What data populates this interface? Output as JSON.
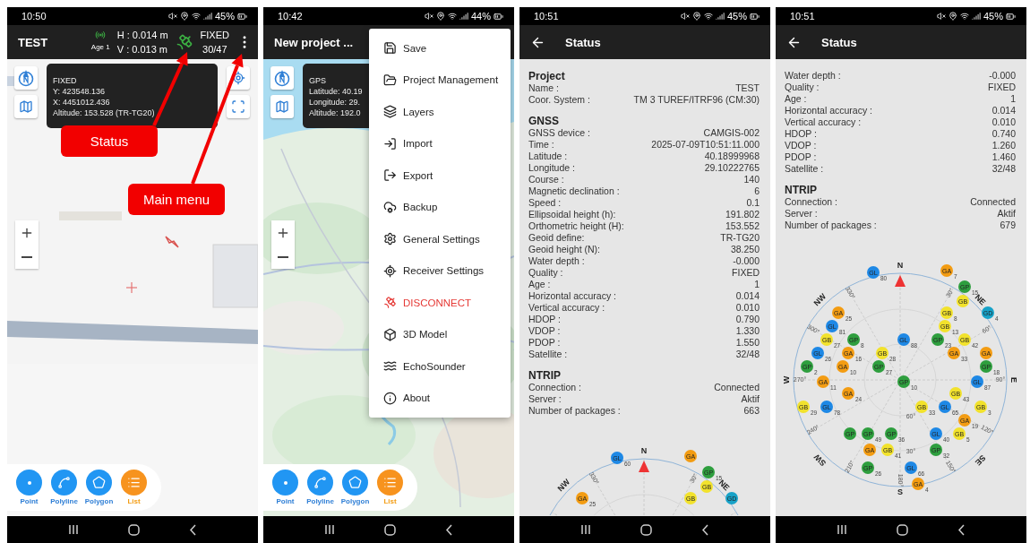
{
  "screens": [
    {
      "kind": "map",
      "status_bar": {
        "time": "10:50",
        "battery": "45%"
      },
      "app_bar": {
        "title": "TEST",
        "gnss": {
          "age": "Age 1",
          "h": "H : 0.014 m",
          "v": "V : 0.013 m",
          "fix": "FIXED",
          "satellites": "30/47"
        }
      },
      "info_card": [
        "FIXED",
        "Y: 423548.136",
        "X: 4451012.436",
        "Altitude: 153.528 (TR-TG20)"
      ],
      "annotations": [
        "Status",
        "Main menu"
      ],
      "toolbar": [
        {
          "label": "Point",
          "kind": "point",
          "selected": false
        },
        {
          "label": "Polyline",
          "kind": "polyline",
          "selected": false
        },
        {
          "label": "Polygon",
          "kind": "polygon",
          "selected": false
        },
        {
          "label": "List",
          "kind": "list",
          "selected": true
        }
      ]
    },
    {
      "kind": "map",
      "status_bar": {
        "time": "10:42",
        "battery": "44%"
      },
      "app_bar": {
        "title": "New project ..."
      },
      "info_card": [
        "GPS",
        "Latitude: 40.19",
        "Longitude: 29.",
        "Altitude: 192.0"
      ],
      "menu": [
        {
          "label": "Save",
          "kind": "normal"
        },
        {
          "label": "Project Management",
          "kind": "normal"
        },
        {
          "label": "Layers",
          "kind": "normal"
        },
        {
          "label": "Import",
          "kind": "normal"
        },
        {
          "label": "Export",
          "kind": "normal"
        },
        {
          "label": "Backup",
          "kind": "normal"
        },
        {
          "label": "General Settings",
          "kind": "normal"
        },
        {
          "label": "Receiver Settings",
          "kind": "normal"
        },
        {
          "label": "DISCONNECT",
          "kind": "danger"
        },
        {
          "label": "3D Model",
          "kind": "normal"
        },
        {
          "label": "EchoSounder",
          "kind": "normal"
        },
        {
          "label": "About",
          "kind": "normal"
        }
      ],
      "toolbar": [
        {
          "label": "Point",
          "kind": "point",
          "selected": false
        },
        {
          "label": "Polyline",
          "kind": "polyline",
          "selected": false
        },
        {
          "label": "Polygon",
          "kind": "polygon",
          "selected": false
        },
        {
          "label": "List",
          "kind": "list",
          "selected": true
        }
      ]
    },
    {
      "kind": "status",
      "status_bar": {
        "time": "10:51",
        "battery": "45%"
      },
      "app_bar": {
        "title": "Status"
      },
      "sections": [
        {
          "title": "Project",
          "rows": [
            {
              "label": "Name :",
              "value": "TEST"
            },
            {
              "label": "Coor. System :",
              "value": "TM 3 TUREF/ITRF96 (CM:30)"
            }
          ]
        },
        {
          "title": "GNSS",
          "rows": [
            {
              "label": "GNSS device :",
              "value": "CAMGIS-002"
            },
            {
              "label": "Time :",
              "value": "2025-07-09T10:51:11.000"
            },
            {
              "label": "Latitude :",
              "value": "40.18999968"
            },
            {
              "label": "Longitude :",
              "value": "29.10222765"
            },
            {
              "label": "Course :",
              "value": "140"
            },
            {
              "label": "Magnetic declination :",
              "value": "6"
            },
            {
              "label": "Speed :",
              "value": "0.1"
            },
            {
              "label": "Ellipsoidal height (h):",
              "value": "191.802"
            },
            {
              "label": "Orthometric height (H):",
              "value": "153.552"
            },
            {
              "label": "Geoid define:",
              "value": "TR-TG20"
            },
            {
              "label": "Geoid height (N):",
              "value": "38.250"
            },
            {
              "label": "Water depth :",
              "value": "-0.000"
            },
            {
              "label": "Quality :",
              "value": "FIXED"
            },
            {
              "label": "Age :",
              "value": "1"
            },
            {
              "label": "Horizontal accuracy :",
              "value": "0.014"
            },
            {
              "label": "Vertical accuracy :",
              "value": "0.010"
            },
            {
              "label": "HDOP :",
              "value": "0.790"
            },
            {
              "label": "VDOP :",
              "value": "1.330"
            },
            {
              "label": "PDOP :",
              "value": "1.550"
            },
            {
              "label": "Satellite :",
              "value": "32/48"
            }
          ]
        },
        {
          "title": "NTRIP",
          "rows": [
            {
              "label": "Connection :",
              "value": "Connected"
            },
            {
              "label": "Server :",
              "value": "Aktif"
            },
            {
              "label": "Number of packages :",
              "value": "663"
            }
          ]
        }
      ],
      "skyplot": {
        "directions": [
          "N",
          "NE",
          "NW"
        ],
        "azimuth_labels": [
          "330°",
          "30°"
        ],
        "satellites": [
          {
            "system": "GL",
            "number": "60",
            "color": "#1e88e5"
          },
          {
            "system": "GA",
            "color": "#f39c12"
          },
          {
            "system": "GP",
            "number": "15",
            "color": "#2e9e3e"
          },
          {
            "system": "GB",
            "color": "#f2e22c"
          },
          {
            "system": "GA",
            "number": "25",
            "color": "#f39c12"
          },
          {
            "system": "GB",
            "color": "#f2e22c"
          },
          {
            "system": "GD",
            "color": "#17a2c8"
          }
        ]
      }
    },
    {
      "kind": "status",
      "status_bar": {
        "time": "10:51",
        "battery": "45%"
      },
      "app_bar": {
        "title": "Status"
      },
      "sections": [
        {
          "rows": [
            {
              "label": "Water depth :",
              "value": "-0.000"
            },
            {
              "label": "Quality :",
              "value": "FIXED"
            },
            {
              "label": "Age :",
              "value": "1"
            },
            {
              "label": "Horizontal accuracy :",
              "value": "0.014"
            },
            {
              "label": "Vertical accuracy :",
              "value": "0.010"
            },
            {
              "label": "HDOP :",
              "value": "0.740"
            },
            {
              "label": "VDOP :",
              "value": "1.260"
            },
            {
              "label": "PDOP :",
              "value": "1.460"
            },
            {
              "label": "Satellite :",
              "value": "32/48"
            }
          ]
        },
        {
          "title": "NTRIP",
          "rows": [
            {
              "label": "Connection :",
              "value": "Connected"
            },
            {
              "label": "Server :",
              "value": "Aktif"
            },
            {
              "label": "Number of packages :",
              "value": "679"
            }
          ]
        }
      ],
      "skyplot": {
        "directions": [
          "N",
          "NE",
          "NW",
          "E",
          "W",
          "SE",
          "SW",
          "S"
        ],
        "azimuth_labels": [
          "330°",
          "30°",
          "300°",
          "60°",
          "270°",
          "90°",
          "240°",
          "120°",
          "210°",
          "150°",
          "180°"
        ],
        "elevation_labels": [
          "60°",
          "30°"
        ],
        "satellites": [
          {
            "system": "GL",
            "number": "80",
            "color": "#1e88e5"
          },
          {
            "system": "GA",
            "number": "7",
            "color": "#f39c12"
          },
          {
            "system": "GP",
            "number": "15",
            "color": "#2e9e3e"
          },
          {
            "system": "GB",
            "color": "#f2e22c"
          },
          {
            "system": "GA",
            "number": "25",
            "color": "#f39c12"
          },
          {
            "system": "GB",
            "number": "8",
            "color": "#f2e22c"
          },
          {
            "system": "GD",
            "number": "4",
            "color": "#17a2c8"
          },
          {
            "system": "GL",
            "number": "81",
            "color": "#1e88e5"
          },
          {
            "system": "GB",
            "number": "13",
            "color": "#f2e22c"
          },
          {
            "system": "GB",
            "number": "27",
            "color": "#f2e22c"
          },
          {
            "system": "GP",
            "number": "8",
            "color": "#2e9e3e"
          },
          {
            "system": "GL",
            "number": "88",
            "color": "#1e88e5"
          },
          {
            "system": "GP",
            "number": "23",
            "color": "#2e9e3e"
          },
          {
            "system": "GB",
            "number": "42",
            "color": "#f2e22c"
          },
          {
            "system": "GL",
            "number": "26",
            "color": "#1e88e5"
          },
          {
            "system": "GA",
            "number": "16",
            "color": "#f39c12"
          },
          {
            "system": "GB",
            "number": "28",
            "color": "#f2e22c"
          },
          {
            "system": "GA",
            "number": "33",
            "color": "#f39c12"
          },
          {
            "system": "GA",
            "color": "#f39c12"
          },
          {
            "system": "GP",
            "number": "2",
            "color": "#2e9e3e"
          },
          {
            "system": "GA",
            "number": "10",
            "color": "#f39c12"
          },
          {
            "system": "GP",
            "number": "27",
            "color": "#2e9e3e"
          },
          {
            "system": "GP",
            "number": "18",
            "color": "#2e9e3e"
          },
          {
            "system": "GA",
            "number": "11",
            "color": "#f39c12"
          },
          {
            "system": "GP",
            "number": "10",
            "color": "#2e9e3e"
          },
          {
            "system": "GL",
            "number": "87",
            "color": "#1e88e5"
          },
          {
            "system": "GA",
            "number": "24",
            "color": "#f39c12"
          },
          {
            "system": "GB",
            "number": "43",
            "color": "#f2e22c"
          },
          {
            "system": "GB",
            "number": "29",
            "color": "#f2e22c"
          },
          {
            "system": "GL",
            "number": "78",
            "color": "#1e88e5"
          },
          {
            "system": "GB",
            "number": "33",
            "color": "#f2e22c"
          },
          {
            "system": "GL",
            "number": "65",
            "color": "#1e88e5"
          },
          {
            "system": "GB",
            "number": "3",
            "color": "#f2e22c"
          },
          {
            "system": "GA",
            "number": "19",
            "color": "#f39c12"
          },
          {
            "system": "GP",
            "color": "#2e9e3e"
          },
          {
            "system": "GP",
            "number": "49",
            "color": "#2e9e3e"
          },
          {
            "system": "GP",
            "number": "36",
            "color": "#2e9e3e"
          },
          {
            "system": "GL",
            "number": "40",
            "color": "#1e88e5"
          },
          {
            "system": "GB",
            "number": "5",
            "color": "#f2e22c"
          },
          {
            "system": "GA",
            "color": "#f39c12"
          },
          {
            "system": "GB",
            "number": "41",
            "color": "#f2e22c"
          },
          {
            "system": "GP",
            "number": "32",
            "color": "#2e9e3e"
          },
          {
            "system": "GP",
            "number": "26",
            "color": "#2e9e3e"
          },
          {
            "system": "GL",
            "number": "66",
            "color": "#1e88e5"
          },
          {
            "system": "GA",
            "number": "4",
            "color": "#f39c12"
          }
        ]
      }
    }
  ]
}
